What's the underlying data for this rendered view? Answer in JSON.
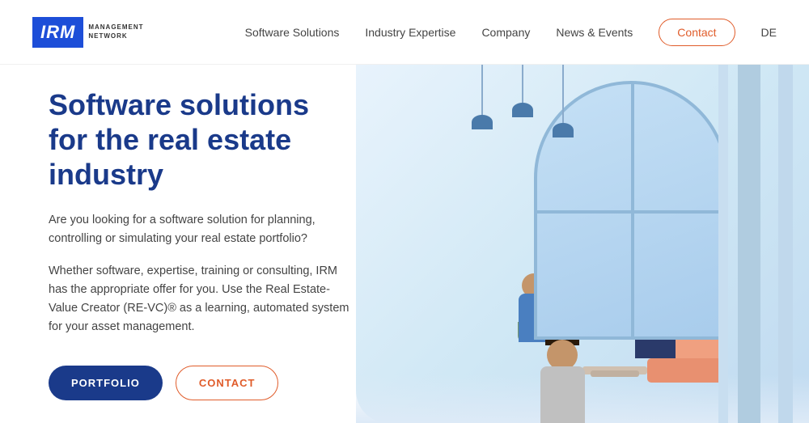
{
  "header": {
    "logo": {
      "text": "IRM",
      "subtitle": "MANAGEMENT NETWORK"
    },
    "nav": {
      "items": [
        {
          "id": "software-solutions",
          "label": "Software Solutions"
        },
        {
          "id": "industry-expertise",
          "label": "Industry Expertise"
        },
        {
          "id": "company",
          "label": "Company"
        },
        {
          "id": "news-events",
          "label": "News & Events"
        }
      ],
      "contact_label": "Contact",
      "language_label": "DE"
    }
  },
  "hero": {
    "title": "Software solutions for the real estate industry",
    "description1": "Are you looking for a software solution for planning, controlling or simulating your real estate portfolio?",
    "description2": "Whether software, expertise, training or consulting, IRM has the appropriate offer for you. Use the Real Estate-Value Creator (RE-VC)® as a learning, automated system for your asset management.",
    "btn_portfolio": "PORTFOLIO",
    "btn_contact": "CONTACT"
  },
  "colors": {
    "brand_blue": "#1a3a8a",
    "accent_orange": "#e05c2a",
    "bg_scene": "#d8ebf7"
  }
}
